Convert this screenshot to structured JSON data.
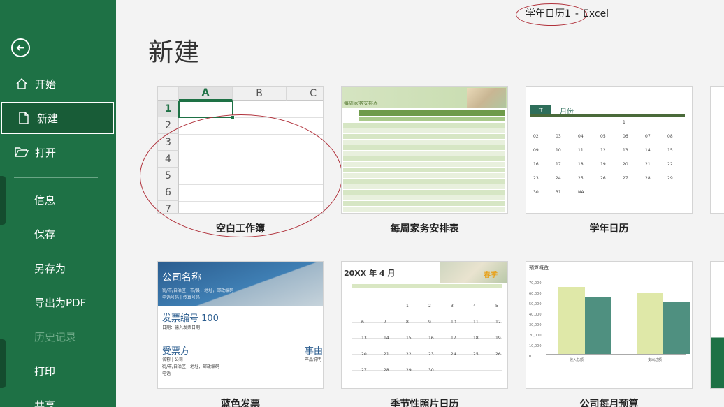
{
  "window": {
    "title": "学年日历1",
    "dash": "-",
    "app": "Excel"
  },
  "sidebar": {
    "items": [
      {
        "label": "开始",
        "icon": "home-icon"
      },
      {
        "label": "新建",
        "icon": "new-document-icon",
        "active": true
      },
      {
        "label": "打开",
        "icon": "open-folder-icon"
      },
      {
        "label": "信息"
      },
      {
        "label": "保存"
      },
      {
        "label": "另存为"
      },
      {
        "label": "导出为PDF"
      },
      {
        "label": "历史记录",
        "disabled": true
      },
      {
        "label": "打印"
      },
      {
        "label": "共享"
      }
    ],
    "colors": {
      "bg": "#1e7145",
      "active": "#185c37"
    }
  },
  "page": {
    "title": "新建"
  },
  "templates": [
    {
      "label": "空白工作簿"
    },
    {
      "label": "每周家务安排表"
    },
    {
      "label": "学年日历"
    },
    {
      "label": "蓝色发票"
    },
    {
      "label": "季节性照片日历"
    },
    {
      "label": "公司每月预算"
    }
  ],
  "blank_preview": {
    "columns": [
      "A",
      "B",
      "C"
    ],
    "rows": [
      "1",
      "2",
      "3",
      "4",
      "5",
      "6",
      "7"
    ]
  },
  "chores_preview": {
    "title": "每周家务安排表"
  },
  "calendar_preview": {
    "tab": "年",
    "month": "月份",
    "rows": [
      [
        "",
        "",
        "",
        "",
        "1",
        "",
        ""
      ],
      [
        "02",
        "03",
        "04",
        "05",
        "06",
        "07",
        "08"
      ],
      [
        "09",
        "10",
        "11",
        "12",
        "13",
        "14",
        "15"
      ],
      [
        "16",
        "17",
        "18",
        "19",
        "20",
        "21",
        "22"
      ],
      [
        "23",
        "24",
        "25",
        "26",
        "27",
        "28",
        "29"
      ],
      [
        "30",
        "31",
        "NA",
        "",
        "",
        "",
        ""
      ]
    ]
  },
  "invoice_preview": {
    "company": "公司名称",
    "address": "街/市/自治区，市/县，地址，邮政编码",
    "contact": "电话号码 | 传真号码",
    "invoice_no": "发票编号 100",
    "date": "日期：输入发票日期",
    "to": "受票方",
    "to_name": "名称 | 公司",
    "to_addr": "街/市/自治区，地址，邮政编码",
    "to_phone": "电话",
    "reason": "事由",
    "reason_desc": "产品说明"
  },
  "seasonal_preview": {
    "title": "20XX 年 4 月",
    "tag": "春季",
    "dates": [
      "1",
      "2",
      "3",
      "4",
      "5",
      "6",
      "7",
      "8",
      "9",
      "10",
      "11",
      "12",
      "13",
      "14",
      "15",
      "16",
      "17",
      "18",
      "19",
      "20",
      "21",
      "22",
      "23",
      "24",
      "25",
      "26",
      "27",
      "28",
      "29",
      "30"
    ]
  },
  "budget_preview": {
    "title": "预算概览",
    "y_ticks": [
      "70,000",
      "60,000",
      "50,000",
      "40,000",
      "30,000",
      "20,000",
      "10,000",
      "0"
    ],
    "groups": [
      {
        "label": "收入总额",
        "values": [
          64000,
          55000
        ]
      },
      {
        "label": "支出总额",
        "values": [
          59000,
          50000
        ]
      }
    ],
    "colors": [
      "#dfe8a8",
      "#4f9080"
    ]
  }
}
